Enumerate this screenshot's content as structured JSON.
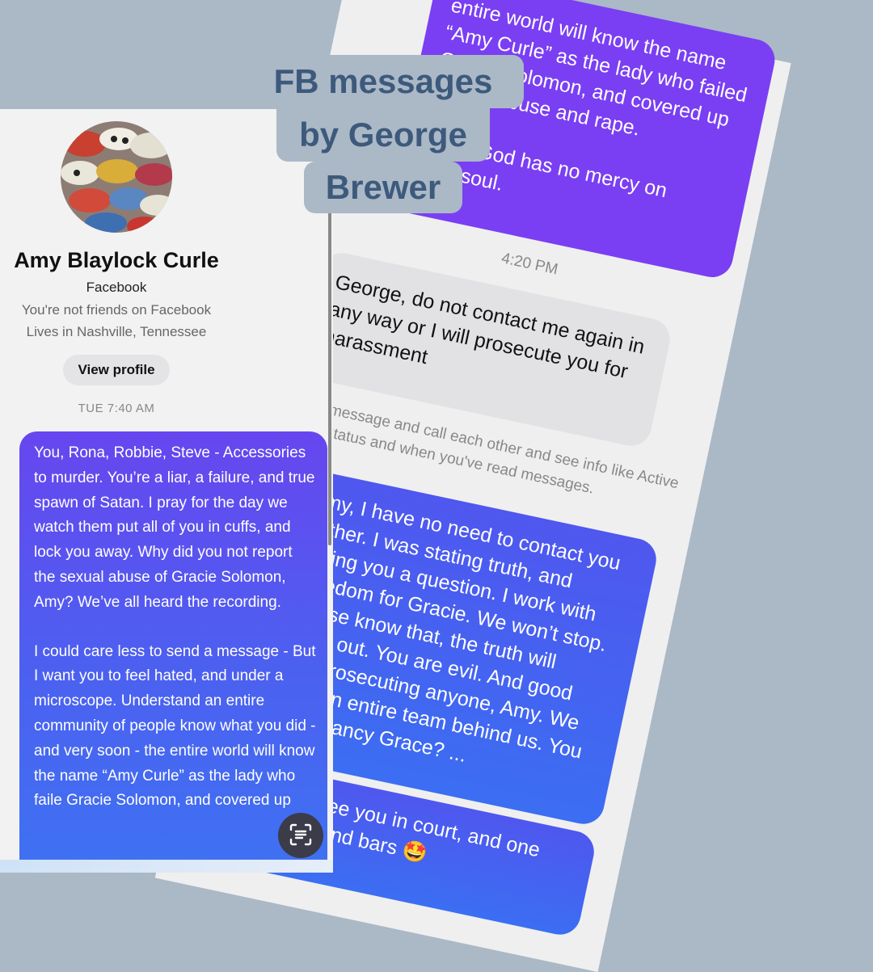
{
  "title": {
    "line1": "FB messages",
    "line2": "by George",
    "line3": "Brewer"
  },
  "profile": {
    "name": "Amy Blaylock Curle",
    "platform": "Facebook",
    "friend_status": "You're not friends on Facebook",
    "location": "Lives in Nashville, Tennessee",
    "view_profile_label": "View profile",
    "avatar_icon": "umbrellas-photo-avatar"
  },
  "left_thread": {
    "timestamp": "TUE 7:40 AM",
    "message_paragraphs": [
      "You, Rona, Robbie, Steve - Accessories to murder. You’re a liar, a failure, and true spawn of Satan. I pray for the day we watch them put all of you in cuffs, and lock you away. Why did you not report the sexual abuse of Gracie Solomon, Amy? We’ve all heard the recording.",
      "I could care less to send a message - But I want you to feel hated, and under a microscope. Understand an entire community of people know what you did - and very soon - the entire world will know the name “Amy Curle” as the lady who faile Gracie Solomon, and covered up"
    ],
    "scan_icon": "scan-text-icon"
  },
  "right_thread": {
    "top_bubble": "entire world will know the name\n“Amy Curle” as the lady who failed\nGracie Solomon, and covered up\nsexual abuse and rape.\n\nI pray God has no mercy on\nyour soul.",
    "time": "4:20 PM",
    "reply": "George, do not contact me again in\nany way or I will prosecute you for\nharassment",
    "notice": "ou can now message and call each other and see info like Active\nStatus and when you've read messages.",
    "bubble_2": "Amy, I have no need to contact you\nfurther. I was stating truth, and\nasking you a question. I work with\nFreedom for Gracie. We won’t stop.\nPlease know that, the truth will\ncome out. You are evil. And good\nluck prosecuting anyone, Amy. We\nhave an entire team behind us. You\nknow Nancy Grace? ...",
    "bubble_3": "We will see you in court, and one\nday - behind bars 🤩"
  },
  "colors": {
    "background": "#abb8c6",
    "title_text": "#3d5a7c",
    "bubble_purple": "#7a3ff2",
    "bubble_blue": "#3b6ef2",
    "bubble_grey": "#e2e2e4"
  }
}
